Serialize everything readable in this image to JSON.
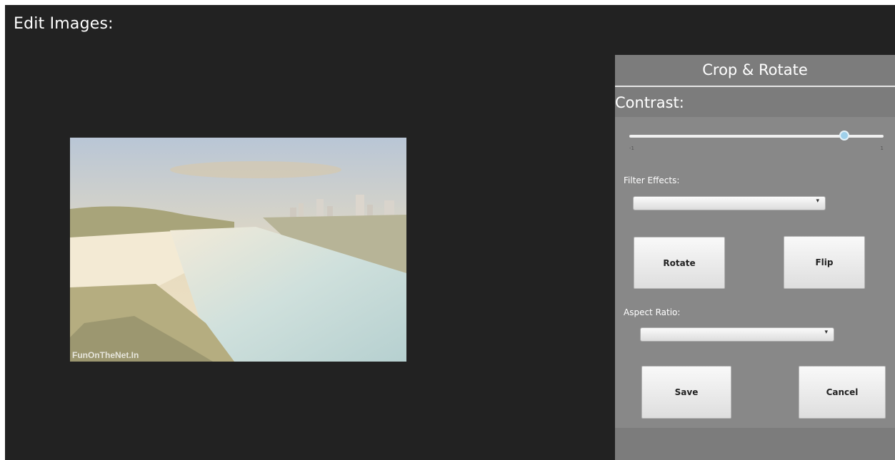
{
  "page": {
    "title": "Edit Images:"
  },
  "image": {
    "watermark": "FunOnTheNet.In"
  },
  "panel": {
    "header": "Crop & Rotate",
    "contrast_label": "Contrast:",
    "contrast": {
      "min": "-1",
      "max": "1",
      "value": 0.86
    },
    "filter_label": "Filter Effects:",
    "filter_value": "",
    "rotate_button": "Rotate",
    "flip_button": "Flip",
    "aspect_label": "Aspect Ratio:",
    "aspect_value": "",
    "save_button": "Save",
    "cancel_button": "Cancel",
    "dropdown_icon": "chevron-down-icon"
  }
}
